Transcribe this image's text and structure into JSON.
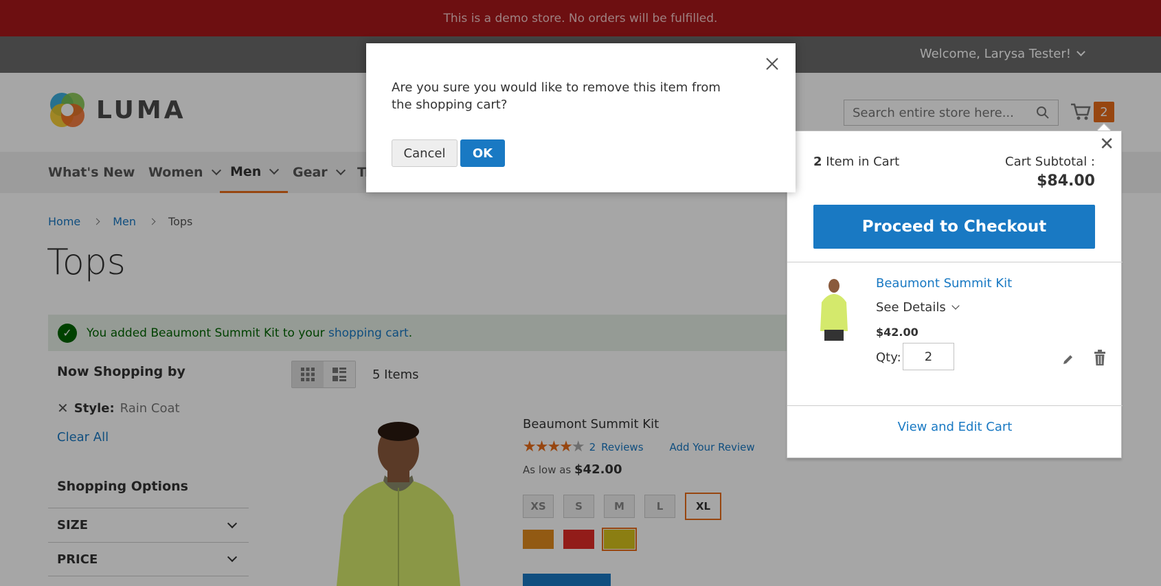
{
  "notice": "This is a demo store. No orders will be fulfilled.",
  "header": {
    "welcome": "Welcome, Larysa Tester!",
    "logo_text": "LUMA",
    "search_placeholder": "Search entire store here...",
    "cart_count": "2"
  },
  "nav": {
    "items": [
      {
        "label": "What's New"
      },
      {
        "label": "Women"
      },
      {
        "label": "Men"
      },
      {
        "label": "Gear"
      },
      {
        "label": "Tr"
      }
    ]
  },
  "breadcrumb": [
    "Home",
    "Men",
    "Tops"
  ],
  "page_title": "Tops",
  "message": {
    "text": "You added Beaumont Summit Kit to your",
    "link": "shopping cart",
    "end": "."
  },
  "sidebar": {
    "now_shopping": "Now Shopping by",
    "filter_label": "Style:",
    "filter_value": "Rain Coat",
    "clear_all": "Clear All",
    "shopping_options": "Shopping Options",
    "filters": [
      "SIZE",
      "PRICE"
    ]
  },
  "toolbar": {
    "amount": "5 Items"
  },
  "product": {
    "name": "Beaumont Summit Kit",
    "reviews_count": "2",
    "reviews_label": "Reviews",
    "add_review": "Add Your Review",
    "price_prefix": "As low as",
    "price": "$42.00",
    "sizes": [
      "XS",
      "S",
      "M",
      "L",
      "XL"
    ],
    "selected_size": "XL",
    "colors": [
      "#e08a1e",
      "#e02b27",
      "#d6c21c"
    ],
    "rating_stars": 4.5
  },
  "minicart": {
    "count": "2",
    "count_label": "Item in Cart",
    "subtotal_label": "Cart Subtotal :",
    "subtotal": "$84.00",
    "checkout": "Proceed to Checkout",
    "item_name": "Beaumont Summit Kit",
    "see_details": "See Details",
    "item_price": "$42.00",
    "qty_label": "Qty:",
    "qty": "2",
    "view_edit": "View and Edit Cart"
  },
  "modal": {
    "text": "Are you sure you would like to remove this item from the shopping cart?",
    "cancel": "Cancel",
    "ok": "OK"
  },
  "colors": {
    "notice_bg": "#a8171b",
    "accent": "#1979c3",
    "orange": "#e96c1a"
  }
}
